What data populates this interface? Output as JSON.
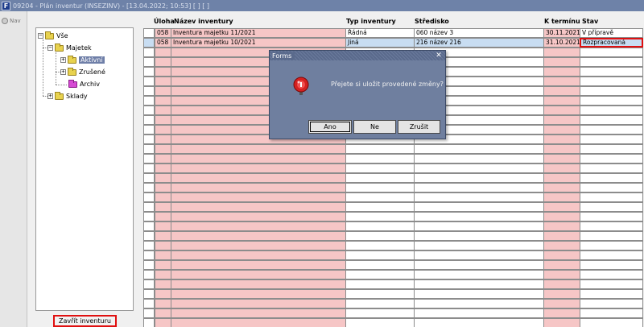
{
  "window": {
    "title": "09204 - Plán inventur (INSEZINV) - [13.04.2022; 10:53] [ ] [ ]",
    "app_icon": "F"
  },
  "nav": {
    "label": "Nav"
  },
  "tree": {
    "root": "Vše",
    "majetek": "Majetek",
    "aktivni": "Aktivní",
    "zrusene": "Zrušené",
    "archiv": "Archiv",
    "sklady": "Sklady"
  },
  "close_inventory_label": "Zavřít inventuru",
  "columns": {
    "uloha": "Úloha",
    "nazev": "Název inventury",
    "typ": "Typ inventury",
    "stredisko": "Středisko",
    "termin": "K termínu",
    "stav": "Stav"
  },
  "rows": [
    {
      "uloha": "058",
      "nazev": "Inventura majetku 11/2021",
      "typ": "Řádná",
      "stredisko": "060 název 3",
      "termin": "30.11.2021",
      "stav": "V přípravě"
    },
    {
      "uloha": "058",
      "nazev": "Inventura majetku 10/2021",
      "typ": "Jiná",
      "stredisko": "216 název 216",
      "termin": "31.10.2021",
      "stav": "Rozpracovaná"
    }
  ],
  "dialog": {
    "title": "Forms",
    "message": "Přejete si uložit provedené změny?",
    "btn_yes": "Ano",
    "btn_no": "Ne",
    "btn_cancel": "Zrušit",
    "icon": "alarm-bell-icon"
  }
}
